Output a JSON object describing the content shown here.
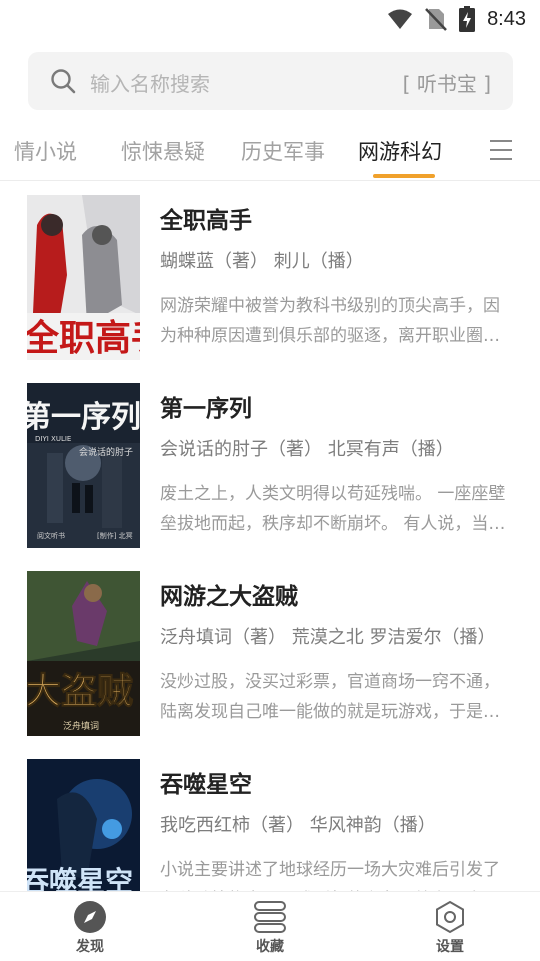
{
  "status_bar": {
    "time": "8:43",
    "icons": [
      "wifi-icon",
      "no-sim-icon",
      "battery-charging-icon"
    ]
  },
  "search": {
    "placeholder": "输入名称搜索",
    "source": "[ 听书宝 ]"
  },
  "tabs": [
    {
      "label": "情小说"
    },
    {
      "label": "惊悚悬疑"
    },
    {
      "label": "历史军事"
    },
    {
      "label": "网游科幻",
      "active": true
    }
  ],
  "accent_color": "#f0a12b",
  "books": [
    {
      "title": "全职高手",
      "author": "蝴蝶蓝（著）  刺儿（播）",
      "desc": "网游荣耀中被誉为教科书级别的顶尖高手，因为种种原因遭到俱乐部的驱逐，离开职业圈的他寄身于一家网吧成了一个小小的网管",
      "cover_text": "全职高手"
    },
    {
      "title": "第一序列",
      "author": "会说话的肘子（著）  北冥有声（播）",
      "desc": "废土之上，人类文明得以苟延残喘。 一座座壁垒拔地而起，秩序却不断崩坏。 有人说，当灾难来临时",
      "cover_text": "第一序列",
      "cover_sub": "DIYI XULIE",
      "cover_author": "会说话的肘子",
      "cover_pub": "阅文听书",
      "cover_pub2": "[制作] 北冥"
    },
    {
      "title": "网游之大盗贼",
      "author": "泛舟填词（著）  荒漠之北 罗洁爱尔（播）",
      "desc": "没炒过股，没买过彩票，官道商场一窍不通，陆离发现自己唯一能做的就是玩游戏，于是他成了一名职业玩家",
      "cover_text": "大盗贼",
      "cover_author": "泛舟填词"
    },
    {
      "title": "吞噬星空",
      "author": "我吃西红柿（著）  华风神韵（播）",
      "desc": "小说主要讲述了地球经历一场大灾难后引发了各种动植物变异，戏剧般的主角罗峰在一次意外中觉醒",
      "cover_text": "吞噬星空"
    }
  ],
  "bottom_nav": [
    {
      "label": "发现",
      "icon": "compass-icon"
    },
    {
      "label": "收藏",
      "icon": "bookshelf-icon"
    },
    {
      "label": "设置",
      "icon": "settings-hexagon-icon"
    }
  ]
}
